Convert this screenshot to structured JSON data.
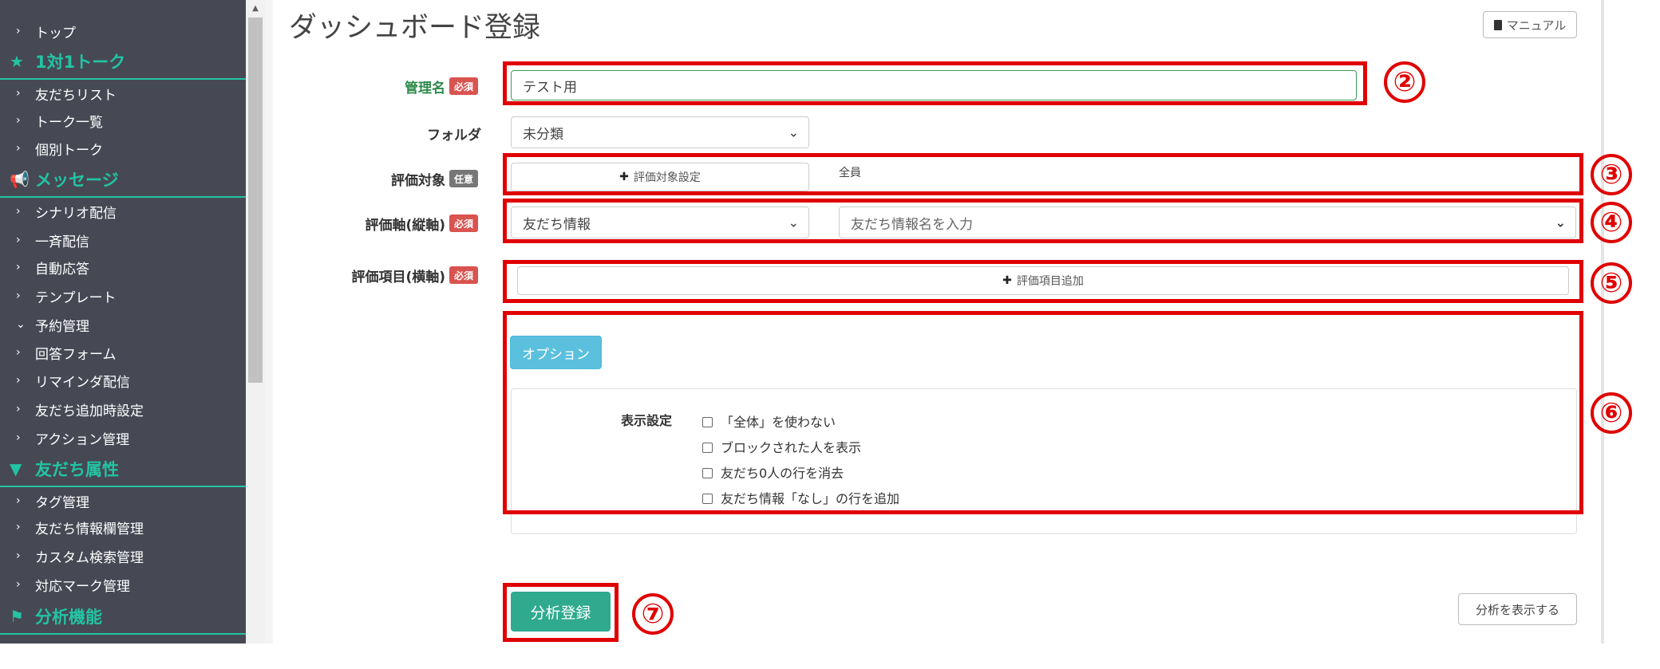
{
  "sidebar": {
    "items": [
      {
        "kind": "item",
        "label": "トップ",
        "chev": "›"
      },
      {
        "kind": "head",
        "label": "1対1トーク",
        "icon": "★"
      },
      {
        "kind": "item",
        "label": "友だちリスト",
        "chev": "›"
      },
      {
        "kind": "item",
        "label": "トーク一覧",
        "chev": "›"
      },
      {
        "kind": "item",
        "label": "個別トーク",
        "chev": "›"
      },
      {
        "kind": "head",
        "label": "メッセージ",
        "icon": "📢"
      },
      {
        "kind": "item",
        "label": "シナリオ配信",
        "chev": "›"
      },
      {
        "kind": "item",
        "label": "一斉配信",
        "chev": "›"
      },
      {
        "kind": "item",
        "label": "自動応答",
        "chev": "›"
      },
      {
        "kind": "item",
        "label": "テンプレート",
        "chev": "›"
      },
      {
        "kind": "item",
        "label": "予約管理",
        "chev": "⌄"
      },
      {
        "kind": "item",
        "label": "回答フォーム",
        "chev": "›"
      },
      {
        "kind": "item",
        "label": "リマインダ配信",
        "chev": "›"
      },
      {
        "kind": "item",
        "label": "友だち追加時設定",
        "chev": "›"
      },
      {
        "kind": "item",
        "label": "アクション管理",
        "chev": "›"
      },
      {
        "kind": "head",
        "label": "友だち属性",
        "icon": "▼"
      },
      {
        "kind": "item",
        "label": "タグ管理",
        "chev": "›"
      },
      {
        "kind": "item",
        "label": "友だち情報欄管理",
        "chev": "›"
      },
      {
        "kind": "item",
        "label": "カスタム検索管理",
        "chev": "›"
      },
      {
        "kind": "item",
        "label": "対応マーク管理",
        "chev": "›"
      },
      {
        "kind": "head",
        "label": "分析機能",
        "icon": "⚑"
      }
    ]
  },
  "header": {
    "title": "ダッシュボード登録",
    "manual_label": "マニュアル",
    "manual_icon": "book-icon"
  },
  "form": {
    "name": {
      "label": "管理名",
      "badge": "必須",
      "value": "テスト用"
    },
    "folder": {
      "label": "フォルダ",
      "value": "未分類"
    },
    "target": {
      "label": "評価対象",
      "badge": "任意",
      "button": "評価対象設定",
      "value": "全員"
    },
    "axis": {
      "label": "評価軸(縦軸)",
      "badge": "必須",
      "select1": "友だち情報",
      "select2_placeholder": "友だち情報名を入力"
    },
    "items": {
      "label": "評価項目(横軸)",
      "badge": "必須",
      "button": "評価項目追加"
    },
    "option": {
      "button": "オプション",
      "display_label": "表示設定",
      "checkboxes": [
        "「全体」を使わない",
        "ブロックされた人を表示",
        "友だち0人の行を消去",
        "友だち情報「なし」の行を追加"
      ]
    },
    "submit": "分析登録",
    "show_analysis": "分析を表示する"
  },
  "annotations": [
    "②",
    "③",
    "④",
    "⑤",
    "⑥",
    "⑦"
  ],
  "colors": {
    "sidebar_bg": "#464954",
    "accent": "#22c4a4",
    "required": "#d9534f",
    "option_btn": "#5bc0de",
    "submit": "#2faa8f",
    "annotation": "#e00000"
  }
}
